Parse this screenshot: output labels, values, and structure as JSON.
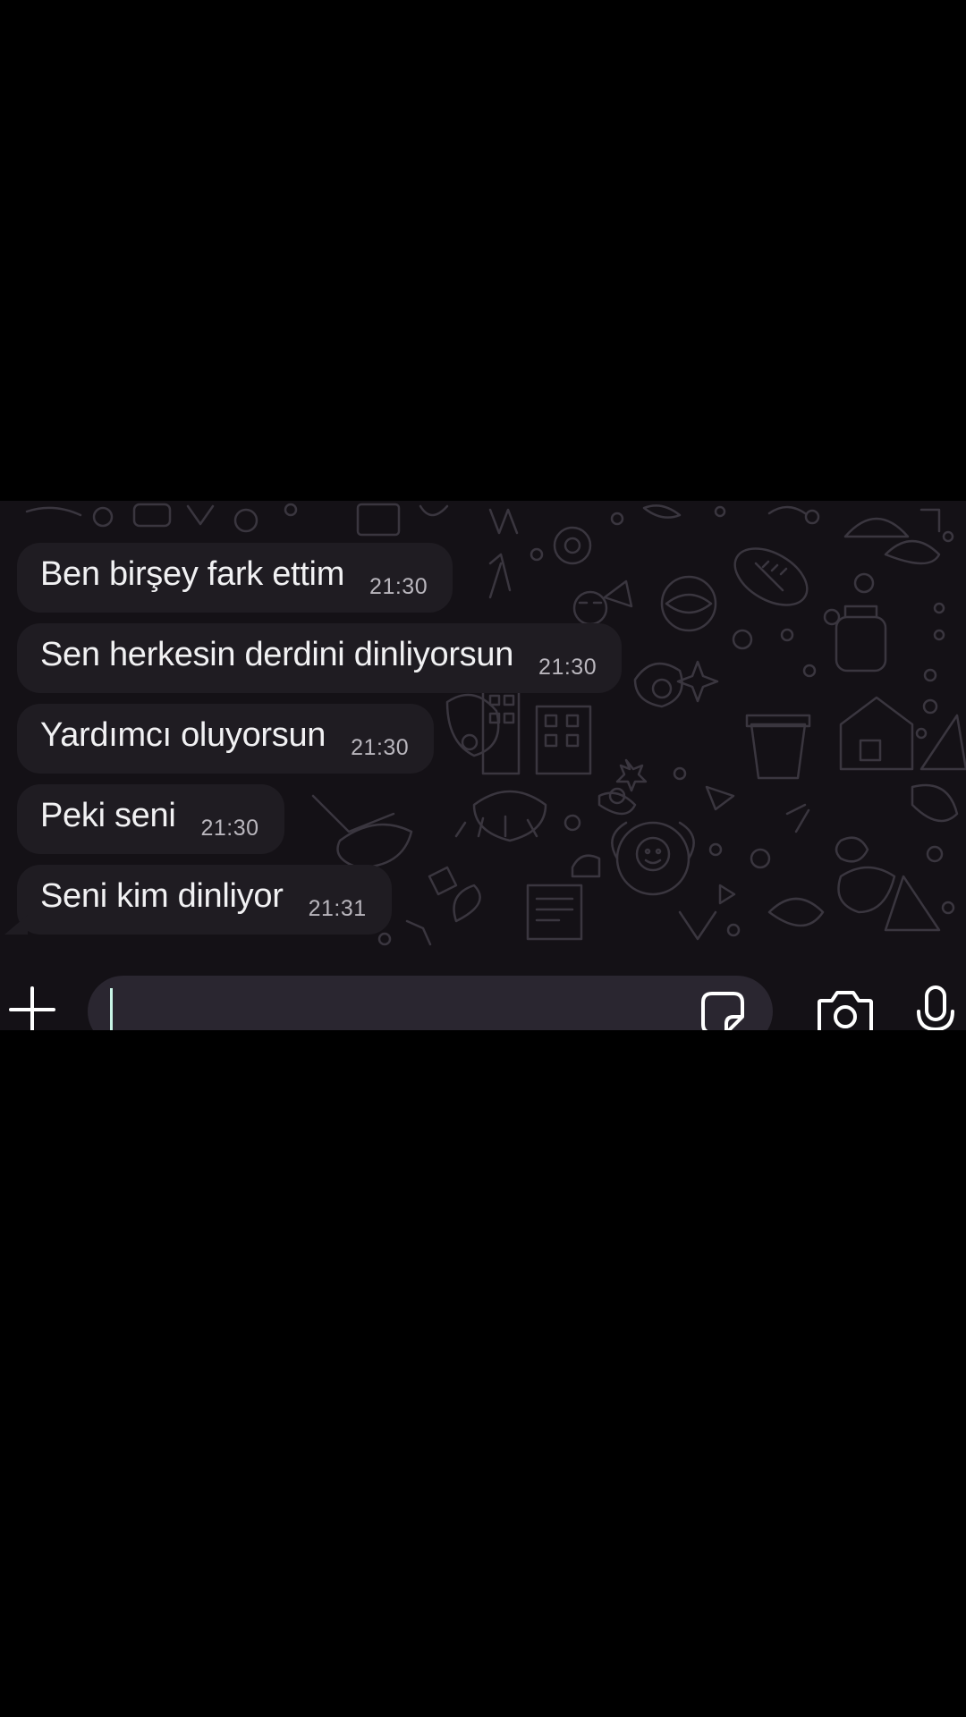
{
  "messages": [
    {
      "text": "Ben birşey fark ettim",
      "time": "21:30"
    },
    {
      "text": "Sen herkesin derdini dinliyorsun",
      "time": "21:30"
    },
    {
      "text": "Yardımcı oluyorsun",
      "time": "21:30"
    },
    {
      "text": "Peki seni",
      "time": "21:30"
    },
    {
      "text": "Seni kim dinliyor",
      "time": "21:31"
    }
  ],
  "input_bar": {
    "value": "",
    "icons": [
      "plus-icon",
      "sticker-icon",
      "camera-icon",
      "microphone-icon"
    ]
  },
  "colors": {
    "background": "#000000",
    "chat_wallpaper": "#141116",
    "bubble": "#1f1c22",
    "message_text": "#f1f1f3",
    "timestamp": "#b9b6bd",
    "input_field": "#2a2630",
    "cursor": "#c9f5e6"
  }
}
